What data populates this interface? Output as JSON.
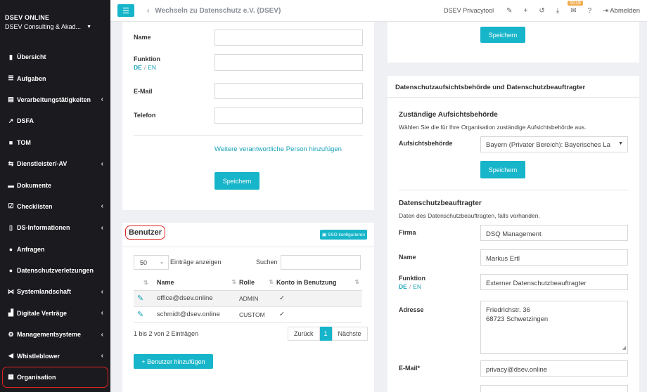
{
  "brand": {
    "title": "DSEV ONLINE",
    "org": "DSEV Consulting & Akad..."
  },
  "nav": [
    {
      "label": "Übersicht",
      "icon": "chart-icon",
      "glyph": "▮",
      "chevron": false
    },
    {
      "label": "Aufgaben",
      "icon": "list-icon",
      "glyph": "☰",
      "chevron": false
    },
    {
      "label": "Verarbeitungstätigkeiten",
      "icon": "table-icon",
      "glyph": "▤",
      "chevron": true
    },
    {
      "label": "DSFA",
      "icon": "chart-line-icon",
      "glyph": "↗",
      "chevron": false
    },
    {
      "label": "TOM",
      "icon": "lock-icon",
      "glyph": "■",
      "chevron": false
    },
    {
      "label": "Dienstleister/-AV",
      "icon": "handshake-icon",
      "glyph": "⇆",
      "chevron": true
    },
    {
      "label": "Dokumente",
      "icon": "folder-icon",
      "glyph": "▬",
      "chevron": false
    },
    {
      "label": "Checklisten",
      "icon": "checklist-icon",
      "glyph": "☑",
      "chevron": true
    },
    {
      "label": "DS-Informationen",
      "icon": "document-icon",
      "glyph": "▯",
      "chevron": true
    },
    {
      "label": "Anfragen",
      "icon": "chat-icon",
      "glyph": "●",
      "chevron": false
    },
    {
      "label": "Datenschutzverletzungen",
      "icon": "alert-icon",
      "glyph": "●",
      "chevron": false
    },
    {
      "label": "Systemlandschaft",
      "icon": "network-icon",
      "glyph": "⋈",
      "chevron": true
    },
    {
      "label": "Digitale Verträge",
      "icon": "contract-icon",
      "glyph": "▟",
      "chevron": true
    },
    {
      "label": "Managementsysteme",
      "icon": "cogs-icon",
      "glyph": "⚙",
      "chevron": true
    },
    {
      "label": "Whistleblower",
      "icon": "megaphone-icon",
      "glyph": "◀",
      "chevron": true
    },
    {
      "label": "Organisation",
      "icon": "building-icon",
      "glyph": "▦",
      "chevron": false,
      "active": true
    }
  ],
  "topbar": {
    "back_label": "Wechseln zu Datenschutz e.V. (DSEV)",
    "tool_label": "DSEV Privacytool",
    "badge": "5019",
    "logout_label": "Abmelden"
  },
  "person_form": {
    "name_label": "Name",
    "function_label": "Funktion",
    "lang_de": "DE",
    "lang_en": "EN",
    "email_label": "E-Mail",
    "phone_label": "Telefon",
    "add_person_link": "Weitere verantwortliche Person hinzufügen",
    "save_label": "Speichern"
  },
  "benutzer": {
    "title": "Benutzer",
    "sso_label": "SSO konfigurieren",
    "page_size": "50",
    "entries_label": "Einträge anzeigen",
    "search_label": "Suchen",
    "columns": [
      "Name",
      "Rolle",
      "Konto in Benutzung"
    ],
    "rows": [
      {
        "name": "office@dsev.online",
        "role": "ADMIN",
        "active": "✓"
      },
      {
        "name": "schmidt@dsev.online",
        "role": "CUSTOM",
        "active": "✓"
      }
    ],
    "info": "1 bis 2 von 2 Einträgen",
    "prev": "Zurück",
    "page": "1",
    "next": "Nächste",
    "add_user": "Benutzer hinzufügen"
  },
  "right": {
    "save_top": "Speichern",
    "section_title": "Datenschutzaufsichtsbehörde und Datenschutzbeauftragter",
    "authority_title": "Zuständige Aufsichtsbehörde",
    "authority_sub": "Wählen Sie die für Ihre Organisation zuständige Aufsichtsbehörde aus.",
    "authority_label": "Aufsichtsbehörde",
    "authority_value": "Bayern (Privater Bereich): Bayerisches La",
    "save_mid": "Speichern",
    "dpo_title": "Datenschutzbeauftragter",
    "dpo_sub": "Daten des Datenschutzbeauftragten, falls vorhanden.",
    "firma_label": "Firma",
    "firma_value": "DSQ Management",
    "name_label": "Name",
    "name_value": "Markus Ertl",
    "function_label": "Funktion",
    "lang_de": "DE",
    "lang_en": "EN",
    "function_value": "Externer Datenschutzbeauftragter",
    "address_label": "Adresse",
    "address_line1": "Friedrichstr. 36",
    "address_line2": "68723 Schwetzingen",
    "email_label": "E-Mail*",
    "email_value": "privacy@dsev.online"
  }
}
